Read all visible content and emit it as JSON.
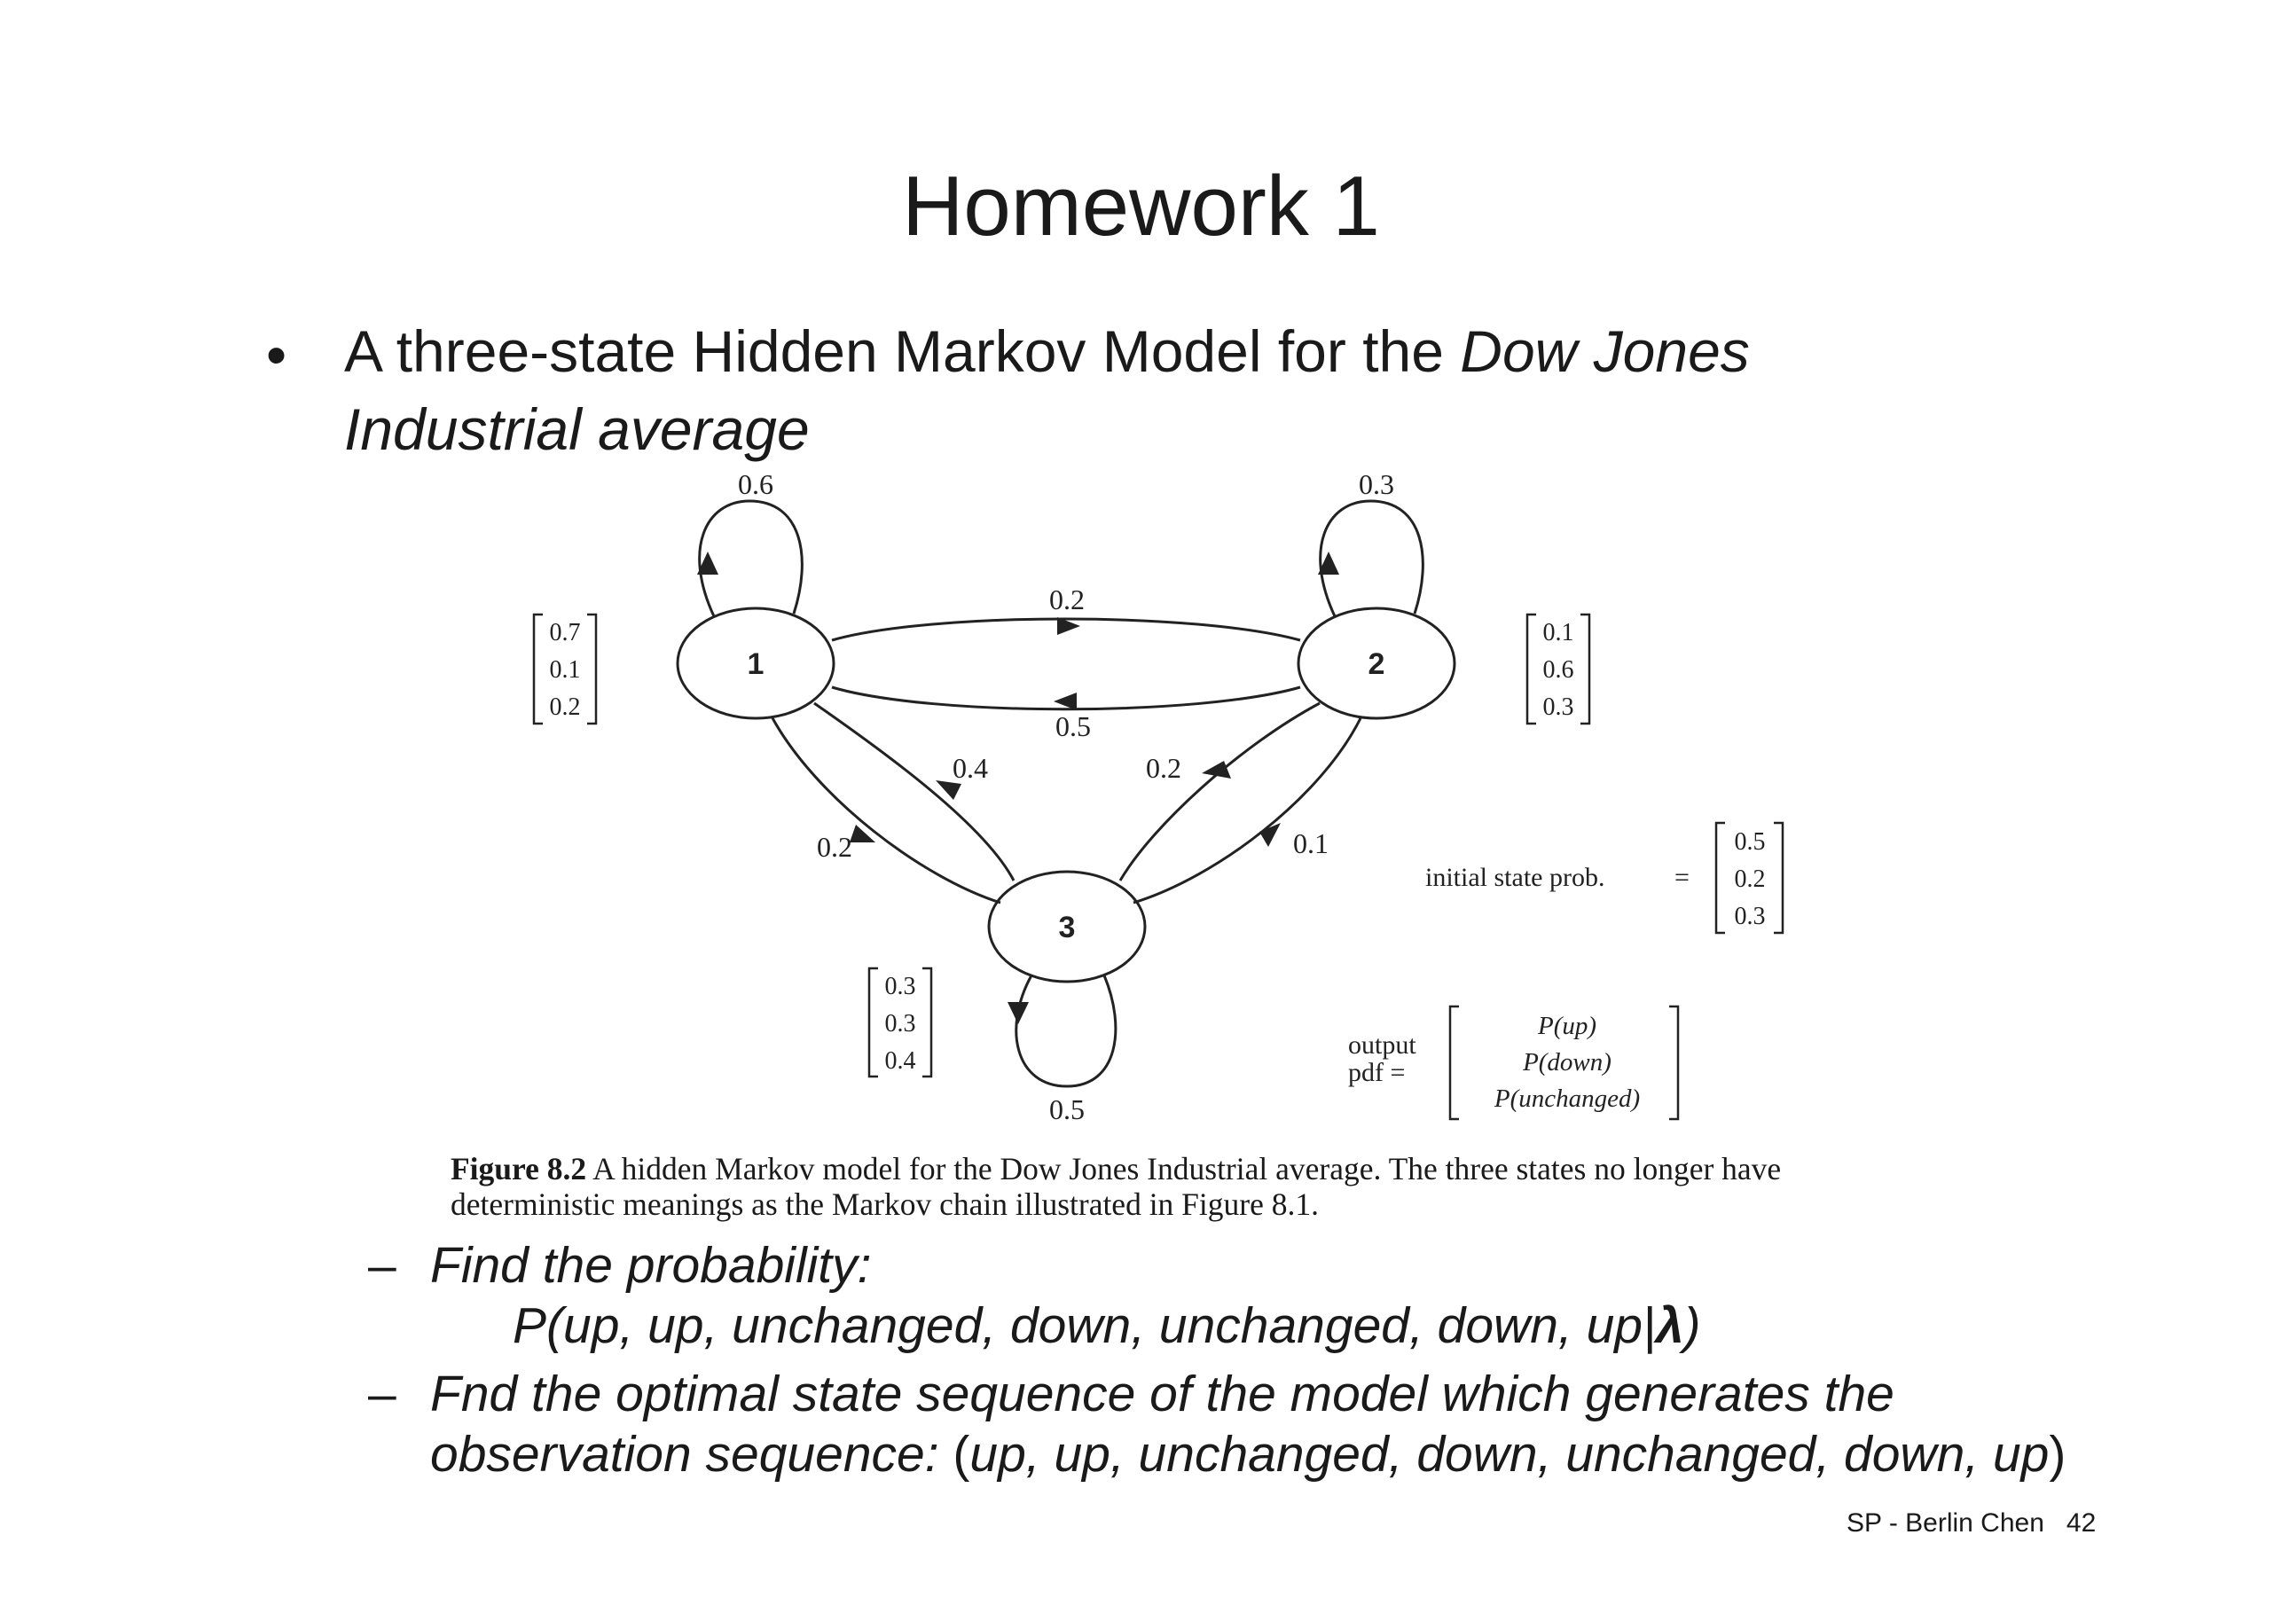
{
  "title": "Homework 1",
  "bullet": {
    "symbol": "•",
    "text_plain": "A three-state Hidden Markov Model for the ",
    "text_italic_1": "Dow Jones",
    "text_italic_2": "Industrial average"
  },
  "diagram": {
    "states": [
      {
        "id": "1",
        "label": "1",
        "output_probs": [
          "0.7",
          "0.1",
          "0.2"
        ]
      },
      {
        "id": "2",
        "label": "2",
        "output_probs": [
          "0.1",
          "0.6",
          "0.3"
        ]
      },
      {
        "id": "3",
        "label": "3",
        "output_probs": [
          "0.3",
          "0.3",
          "0.4"
        ]
      }
    ],
    "transitions": [
      {
        "from": "1",
        "to": "1",
        "prob": "0.6"
      },
      {
        "from": "2",
        "to": "2",
        "prob": "0.3"
      },
      {
        "from": "3",
        "to": "3",
        "prob": "0.5"
      },
      {
        "from": "1",
        "to": "2",
        "prob": "0.2"
      },
      {
        "from": "2",
        "to": "1",
        "prob": "0.5"
      },
      {
        "from": "1",
        "to": "3",
        "prob": "0.2"
      },
      {
        "from": "3",
        "to": "1",
        "prob": "0.4"
      },
      {
        "from": "2",
        "to": "3",
        "prob": "0.2"
      },
      {
        "from": "3",
        "to": "2",
        "prob": "0.1"
      }
    ],
    "initial_label": "initial state prob.",
    "equals": "=",
    "initial_probs": [
      "0.5",
      "0.2",
      "0.3"
    ],
    "output_label_line1": "output",
    "output_label_line2": "pdf =",
    "output_vector": [
      "P(up)",
      "P(down)",
      "P(unchanged)"
    ]
  },
  "caption": {
    "bold": "Figure 8.2",
    "text": " A hidden Markov model for the Dow Jones Industrial average. The three states no longer have deterministic meanings as the Markov chain illustrated in Figure 8.1."
  },
  "subitems": [
    {
      "dash": "–",
      "text": "Find the probability:"
    },
    {
      "dash": "",
      "text_prefix": "P",
      "text": "(up, up, unchanged, down, unchanged, down, up|",
      "lambda": "λ",
      "close": ")"
    },
    {
      "dash": "–",
      "line1": "Fnd the optimal state sequence of the model which generates the",
      "line2_italic": "observation sequence: ",
      "line2_plain_open": "(",
      "line2_seq": "up, up, unchanged, down, unchanged, down, up",
      "line2_plain_close": ")"
    }
  ],
  "footer": {
    "text": "SP - Berlin Chen",
    "page": "42"
  }
}
